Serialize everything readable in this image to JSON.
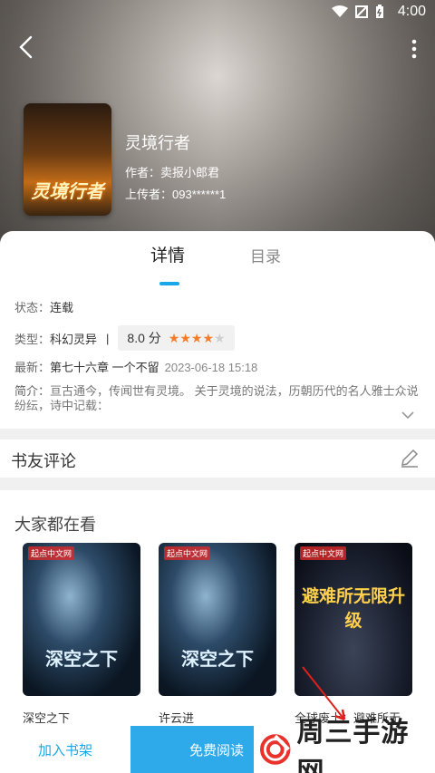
{
  "status_bar": {
    "time": "4:00"
  },
  "book": {
    "cover_title": "灵境行者",
    "title": "灵境行者",
    "author": "作者：卖报小郎君",
    "uploader": "上传者：093******1"
  },
  "tabs": {
    "detail": "详情",
    "toc": "目录"
  },
  "details": {
    "status_label": "状态：",
    "status_value": "连载",
    "type_label": "类型：",
    "type_value": "科幻灵异",
    "separator": "|",
    "score": "8.0 分",
    "stars_filled": 4,
    "stars_total": 5,
    "latest_label": "最新：",
    "latest_value": "第七十六章 一个不留",
    "latest_date": "2023-06-18 15:18",
    "intro_label": "简介：",
    "intro_text": "亘古通今，传闻世有灵境。  关于灵境的说法，历朝历代的名人雅士众说纷纭，诗中记载："
  },
  "comments": {
    "label": "书友评论"
  },
  "recommend": {
    "label": "大家都在看",
    "items": [
      {
        "name": "深空之下",
        "cover_text": "深空之下",
        "brand": "起点中文网"
      },
      {
        "name": "许云进",
        "cover_text": "深空之下",
        "brand": "起点中文网"
      },
      {
        "name": "全球废土：避难所无",
        "cover_text": "避难所无限升级",
        "brand": "起点中文网"
      }
    ]
  },
  "bottom": {
    "add_shelf": "加入书架",
    "free_read": "免费阅读"
  },
  "watermark": {
    "text": "周三手游网"
  },
  "colors": {
    "accent": "#18a7e8",
    "star": "#f07c2c"
  }
}
